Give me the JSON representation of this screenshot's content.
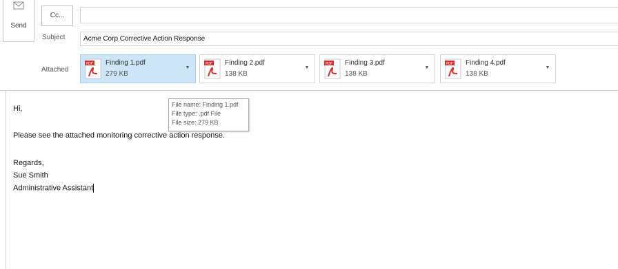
{
  "toolbar": {
    "send_label": "Send",
    "cc_label": "Cc..."
  },
  "subject": {
    "label": "Subject",
    "value": "Acme Corp Corrective Action Response"
  },
  "attachments": {
    "label": "Attached",
    "items": [
      {
        "name": "Finding 1.pdf",
        "size": "279 KB",
        "selected": true
      },
      {
        "name": "Finding 2.pdf",
        "size": "138 KB",
        "selected": false
      },
      {
        "name": "Finding 3.pdf",
        "size": "138 KB",
        "selected": false
      },
      {
        "name": "Finding 4.pdf",
        "size": "138 KB",
        "selected": false
      }
    ]
  },
  "tooltip": {
    "file_name": "File name: Finding 1.pdf",
    "file_type": "File type: .pdf File",
    "file_size": "File size: 279 KB"
  },
  "message": {
    "greeting": "Hi,",
    "line1": "Please see the attached monitoring corrective action response.",
    "closing": "Regards,",
    "signature_name": "Sue Smith",
    "signature_title": "Administrative Assistant"
  },
  "colors": {
    "selected_attachment": "#cde6f7",
    "pdf_red": "#d32f2f"
  },
  "icons": {
    "send": "send-icon",
    "pdf": "pdf-file-icon",
    "dropdown": "chevron-down-icon"
  }
}
